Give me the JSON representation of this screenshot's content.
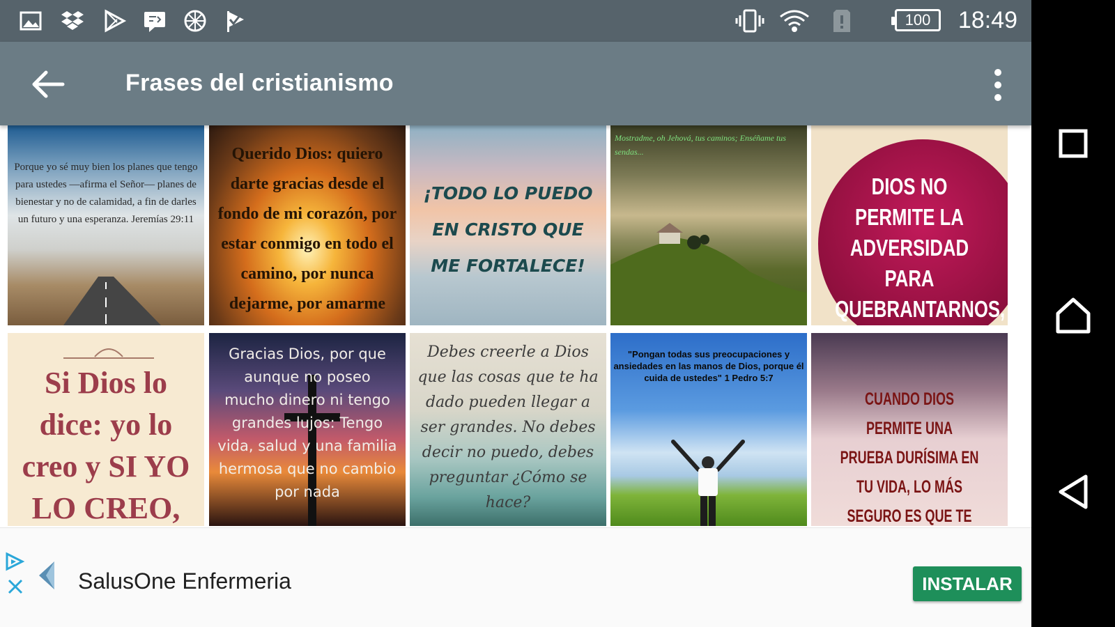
{
  "status_bar": {
    "time": "18:49",
    "battery": "100",
    "left_icons": [
      "image-icon",
      "dropbox-icon",
      "play-store-icon",
      "message-icon",
      "blocked-icon",
      "check-flag-icon"
    ],
    "right_icons": [
      "vibrate-icon",
      "wifi-icon",
      "sim-alert-icon",
      "battery-icon"
    ]
  },
  "toolbar": {
    "title": "Frases del cristianismo",
    "background": "#6b7c85"
  },
  "grid": {
    "tiles": [
      {
        "caption": "Porque yo sé muy bien los planes que tengo para ustedes —afirma el Señor— planes de bienestar y no de calamidad, a fin de darles un futuro y una esperanza. Jeremías 29:11"
      },
      {
        "caption": "Querido Dios: quiero darte gracias desde el fondo de mi corazón, por estar conmigo en todo el camino, por nunca dejarme, por amarme tanto."
      },
      {
        "caption": "¡TODO LO PUEDO EN CRISTO QUE ME FORTALECE!"
      },
      {
        "caption": "Mostradme, oh Jehová, tus caminos; Enséñame tus sendas..."
      },
      {
        "caption": "DIOS NO PERMITE LA ADVERSIDAD PARA QUEBRANTARNOS, SINO PARA MEJORARNOS."
      },
      {
        "caption": "Si Dios lo dice: yo lo creo y SI YO LO CREO, ÉL LO HACE"
      },
      {
        "caption": "Gracias Dios, por que aunque no poseo mucho dinero ni tengo grandes lujos: Tengo vida, salud y una familia hermosa que no cambio por nada"
      },
      {
        "caption": "Debes creerle a Dios que las cosas que te ha dado pueden llegar a ser grandes. No debes decir no puedo, debes preguntar ¿Cómo se hace?"
      },
      {
        "caption": "\"Pongan todas sus preocupaciones y ansiedades en las manos de Dios, porque él cuida de ustedes\" 1 Pedro 5:7"
      },
      {
        "caption": "CUANDO DIOS PERMITE UNA PRUEBA DURÍSIMA EN TU VIDA, LO MÁS SEGURO ES QUE TE ESTÁ PREPARANDO PARA UN MINISTERIO DE MAYOR IMPACTO"
      }
    ]
  },
  "ad": {
    "app_name": "SalusOne Enfermeria",
    "install_label": "INSTALAR",
    "button_color": "#1e8f5a"
  },
  "nav_bar": {
    "buttons": [
      "recents-icon",
      "home-icon",
      "back-nav-icon"
    ]
  }
}
